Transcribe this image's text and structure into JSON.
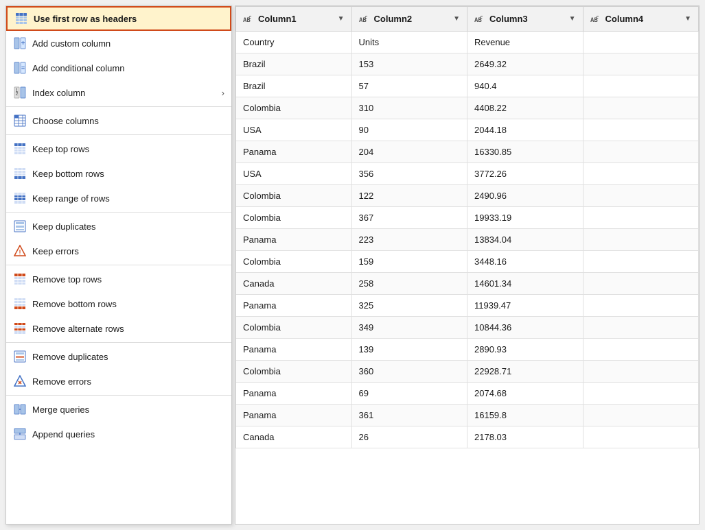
{
  "menu": {
    "items": [
      {
        "id": "use-first-row-headers",
        "label": "Use first row as headers",
        "icon": "table-header-icon",
        "highlighted": true,
        "separator_after": false,
        "has_arrow": false
      },
      {
        "id": "add-custom-column",
        "label": "Add custom column",
        "icon": "custom-col-icon",
        "highlighted": false,
        "separator_after": false,
        "has_arrow": false
      },
      {
        "id": "add-conditional-column",
        "label": "Add conditional column",
        "icon": "conditional-col-icon",
        "highlighted": false,
        "separator_after": false,
        "has_arrow": false
      },
      {
        "id": "index-column",
        "label": "Index column",
        "icon": "index-col-icon",
        "highlighted": false,
        "separator_after": true,
        "has_arrow": true
      },
      {
        "id": "choose-columns",
        "label": "Choose columns",
        "icon": "choose-col-icon",
        "highlighted": false,
        "separator_after": true,
        "has_arrow": false
      },
      {
        "id": "keep-top-rows",
        "label": "Keep top rows",
        "icon": "keep-top-icon",
        "highlighted": false,
        "separator_after": false,
        "has_arrow": false
      },
      {
        "id": "keep-bottom-rows",
        "label": "Keep bottom rows",
        "icon": "keep-bottom-icon",
        "highlighted": false,
        "separator_after": false,
        "has_arrow": false
      },
      {
        "id": "keep-range-of-rows",
        "label": "Keep range of rows",
        "icon": "keep-range-icon",
        "highlighted": false,
        "separator_after": true,
        "has_arrow": false
      },
      {
        "id": "keep-duplicates",
        "label": "Keep duplicates",
        "icon": "keep-dup-icon",
        "highlighted": false,
        "separator_after": false,
        "has_arrow": false
      },
      {
        "id": "keep-errors",
        "label": "Keep errors",
        "icon": "keep-err-icon",
        "highlighted": false,
        "separator_after": true,
        "has_arrow": false
      },
      {
        "id": "remove-top-rows",
        "label": "Remove top rows",
        "icon": "remove-top-icon",
        "highlighted": false,
        "separator_after": false,
        "has_arrow": false
      },
      {
        "id": "remove-bottom-rows",
        "label": "Remove bottom rows",
        "icon": "remove-bottom-icon",
        "highlighted": false,
        "separator_after": false,
        "has_arrow": false
      },
      {
        "id": "remove-alternate-rows",
        "label": "Remove alternate rows",
        "icon": "remove-alt-icon",
        "highlighted": false,
        "separator_after": true,
        "has_arrow": false
      },
      {
        "id": "remove-duplicates",
        "label": "Remove duplicates",
        "icon": "remove-dup-icon",
        "highlighted": false,
        "separator_after": false,
        "has_arrow": false
      },
      {
        "id": "remove-errors",
        "label": "Remove errors",
        "icon": "remove-err-icon",
        "highlighted": false,
        "separator_after": true,
        "has_arrow": false
      },
      {
        "id": "merge-queries",
        "label": "Merge queries",
        "icon": "merge-icon",
        "highlighted": false,
        "separator_after": false,
        "has_arrow": false
      },
      {
        "id": "append-queries",
        "label": "Append queries",
        "icon": "append-icon",
        "highlighted": false,
        "separator_after": false,
        "has_arrow": false
      }
    ]
  },
  "table": {
    "columns": [
      {
        "id": "col1",
        "label": "Column1",
        "type": "ABC"
      },
      {
        "id": "col2",
        "label": "Column2",
        "type": "ABC"
      },
      {
        "id": "col3",
        "label": "Column3",
        "type": "ABC"
      },
      {
        "id": "col4",
        "label": "Column4",
        "type": "ABC"
      }
    ],
    "rows": [
      [
        "Country",
        "Units",
        "Revenue",
        ""
      ],
      [
        "Brazil",
        "153",
        "2649.32",
        ""
      ],
      [
        "Brazil",
        "57",
        "940.4",
        ""
      ],
      [
        "Colombia",
        "310",
        "4408.22",
        ""
      ],
      [
        "USA",
        "90",
        "2044.18",
        ""
      ],
      [
        "Panama",
        "204",
        "16330.85",
        ""
      ],
      [
        "USA",
        "356",
        "3772.26",
        ""
      ],
      [
        "Colombia",
        "122",
        "2490.96",
        ""
      ],
      [
        "Colombia",
        "367",
        "19933.19",
        ""
      ],
      [
        "Panama",
        "223",
        "13834.04",
        ""
      ],
      [
        "Colombia",
        "159",
        "3448.16",
        ""
      ],
      [
        "Canada",
        "258",
        "14601.34",
        ""
      ],
      [
        "Panama",
        "325",
        "11939.47",
        ""
      ],
      [
        "Colombia",
        "349",
        "10844.36",
        ""
      ],
      [
        "Panama",
        "139",
        "2890.93",
        ""
      ],
      [
        "Colombia",
        "360",
        "22928.71",
        ""
      ],
      [
        "Panama",
        "69",
        "2074.68",
        ""
      ],
      [
        "Panama",
        "361",
        "16159.8",
        ""
      ],
      [
        "Canada",
        "26",
        "2178.03",
        ""
      ]
    ]
  },
  "icons": {
    "table-header-icon": "⊞",
    "custom-col-icon": "⊞",
    "conditional-col-icon": "⊞",
    "index-col-icon": "⊞",
    "choose-col-icon": "⊞",
    "keep-top-icon": "▤",
    "keep-bottom-icon": "▤",
    "keep-range-icon": "▤",
    "keep-dup-icon": "",
    "keep-err-icon": "⚑",
    "remove-top-icon": "▤",
    "remove-bottom-icon": "▤",
    "remove-alt-icon": "▤",
    "remove-dup-icon": "⊟",
    "remove-err-icon": "⚑",
    "merge-icon": "⊞",
    "append-icon": "⊞"
  }
}
